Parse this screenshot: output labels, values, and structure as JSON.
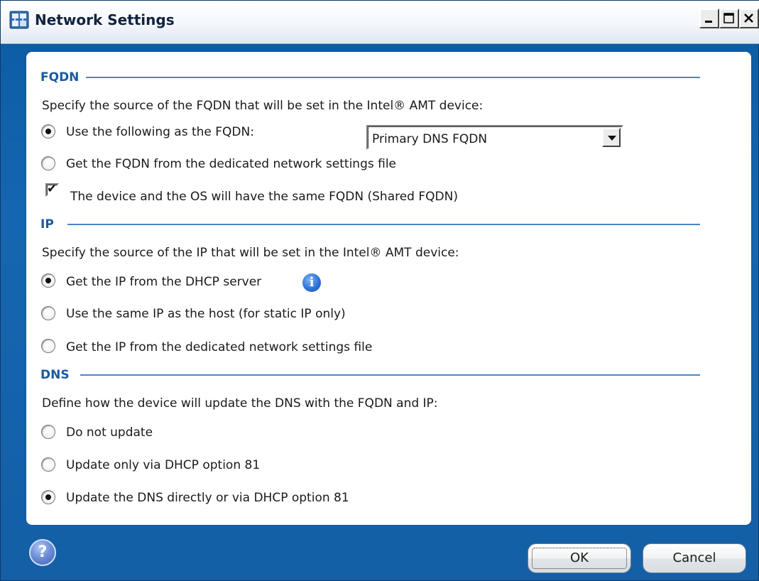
{
  "window": {
    "title": "Network Settings",
    "icon": "network-settings-icon",
    "controls": [
      "minimize",
      "maximize",
      "close"
    ]
  },
  "fqdn": {
    "heading": "FQDN",
    "description": "Specify the source of the FQDN that will be set in the Intel® AMT device:",
    "option_use_following": "Use the following as the FQDN:",
    "option_use_following_selected": true,
    "dropdown_value": "Primary DNS FQDN",
    "option_from_file": "Get the FQDN from the dedicated network settings file",
    "option_from_file_selected": false,
    "shared_checkbox_label": "The device and the OS will have the same FQDN (Shared FQDN)",
    "shared_checkbox_checked": true
  },
  "ip": {
    "heading": "IP",
    "description": "Specify the source of the IP that will be set in the Intel® AMT device:",
    "options": [
      {
        "label": "Get the IP from the DHCP server",
        "selected": true
      },
      {
        "label": "Use the same IP as the host (for static IP only)",
        "selected": false
      },
      {
        "label": "Get the IP from the dedicated network settings file",
        "selected": false
      }
    ],
    "info_icon": "info-icon"
  },
  "dns": {
    "heading": "DNS",
    "description": "Define how the device will update the DNS with the FQDN and IP:",
    "options": [
      {
        "label": "Do not update",
        "selected": false
      },
      {
        "label": "Update only via DHCP option 81",
        "selected": false
      },
      {
        "label": "Update the DNS directly or via DHCP option 81",
        "selected": true
      }
    ]
  },
  "footer": {
    "help_icon": "help-icon",
    "ok_label": "OK",
    "cancel_label": "Cancel"
  },
  "colors": {
    "frame": "#1566b0",
    "section_heading": "#1a5a9e",
    "section_rule": "#4a86c5"
  }
}
